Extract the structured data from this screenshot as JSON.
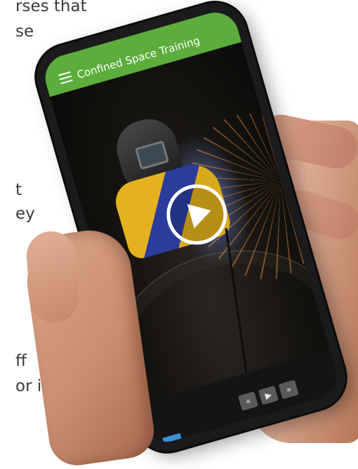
{
  "background_text": [
    "rses that",
    "se",
    "t",
    "ey",
    "ff",
    "or it."
  ],
  "app": {
    "title": "Confined Space Training",
    "header_color": "#5cad3c"
  },
  "video": {
    "play_icon": "play-icon"
  },
  "controls": {
    "prev_label": "«",
    "play_label": "▶",
    "next_label": "»"
  }
}
